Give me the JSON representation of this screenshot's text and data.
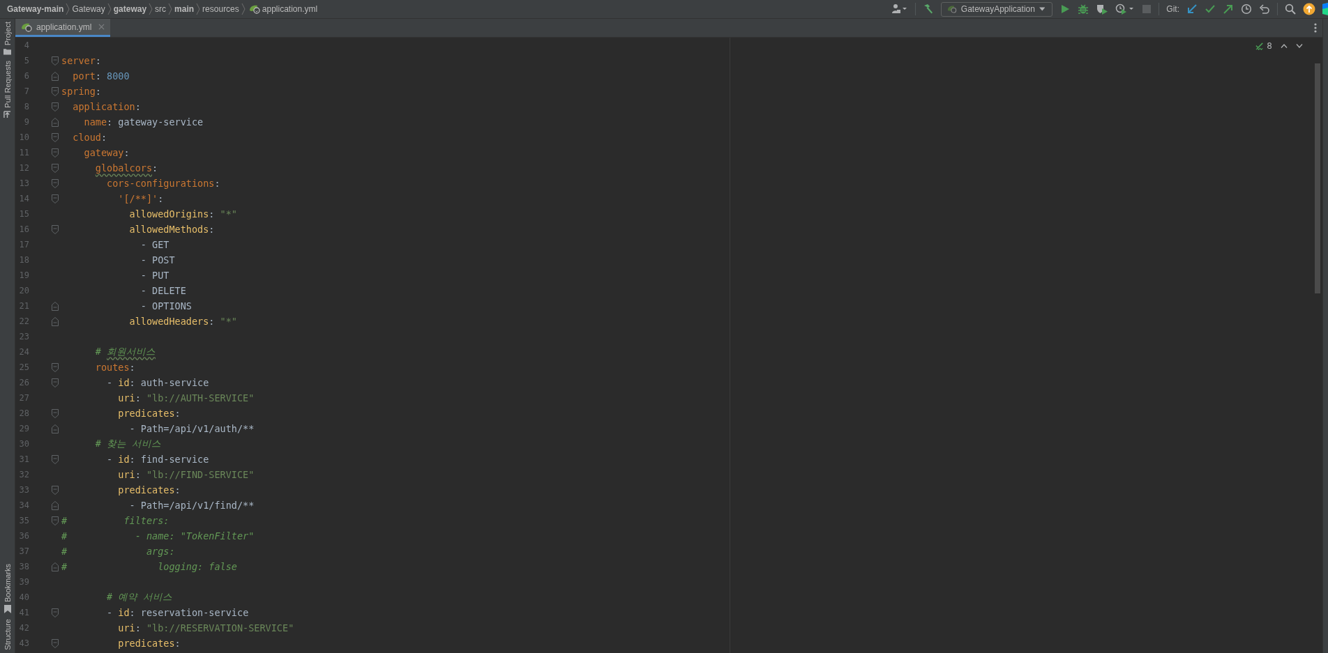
{
  "breadcrumbs": [
    {
      "label": "Gateway-main",
      "bold": true
    },
    {
      "label": "Gateway",
      "bold": false
    },
    {
      "label": "gateway",
      "bold": true
    },
    {
      "label": "src",
      "bold": false
    },
    {
      "label": "main",
      "bold": true
    },
    {
      "label": "resources",
      "bold": false
    },
    {
      "label": "application.yml",
      "bold": false
    }
  ],
  "toolbar": {
    "run_config": "GatewayApplication",
    "git_label": "Git:",
    "stop_disabled": true
  },
  "left_tools": [
    {
      "label": "Project"
    },
    {
      "label": "Pull Requests"
    },
    {
      "label": "Bookmarks"
    },
    {
      "label": "Structure"
    }
  ],
  "tabs": [
    {
      "label": "application.yml",
      "selected": true
    }
  ],
  "inspections": {
    "count": "8"
  },
  "lines": [
    {
      "n": "4",
      "kind": "plain"
    },
    {
      "n": "5",
      "kind": "open",
      "tokens": [
        {
          "kind": "key",
          "text": "server",
          "typo": false
        },
        {
          "kind": "punct",
          "text": ":",
          "typo": false
        }
      ]
    },
    {
      "n": "6",
      "kind": "close",
      "tokens": [
        {
          "kind": "key",
          "text": "  port",
          "typo": false
        },
        {
          "kind": "punct",
          "text": ": ",
          "typo": false
        },
        {
          "kind": "num",
          "text": "8000",
          "typo": false
        }
      ]
    },
    {
      "n": "7",
      "kind": "open",
      "tokens": [
        {
          "kind": "key",
          "text": "spring",
          "typo": false
        },
        {
          "kind": "punct",
          "text": ":",
          "typo": false
        }
      ]
    },
    {
      "n": "8",
      "kind": "open",
      "tokens": [
        {
          "kind": "key",
          "text": "  application",
          "typo": false
        },
        {
          "kind": "punct",
          "text": ":",
          "typo": false
        }
      ]
    },
    {
      "n": "9",
      "kind": "close",
      "tokens": [
        {
          "kind": "key",
          "text": "    name",
          "typo": false
        },
        {
          "kind": "punct",
          "text": ": ",
          "typo": false
        },
        {
          "kind": "val",
          "text": "gateway-service",
          "typo": false
        }
      ]
    },
    {
      "n": "10",
      "kind": "open",
      "tokens": [
        {
          "kind": "key",
          "text": "  cloud",
          "typo": false
        },
        {
          "kind": "punct",
          "text": ":",
          "typo": false
        }
      ]
    },
    {
      "n": "11",
      "kind": "open",
      "tokens": [
        {
          "kind": "key",
          "text": "    gateway",
          "typo": false
        },
        {
          "kind": "punct",
          "text": ":",
          "typo": false
        }
      ]
    },
    {
      "n": "12",
      "kind": "open",
      "tokens": [
        {
          "kind": "key",
          "text": "      globalcors",
          "typo": true
        },
        {
          "kind": "punct",
          "text": ":",
          "typo": false
        }
      ]
    },
    {
      "n": "13",
      "kind": "open",
      "tokens": [
        {
          "kind": "key",
          "text": "        cors-configurations",
          "typo": false
        },
        {
          "kind": "punct",
          "text": ":",
          "typo": false
        }
      ]
    },
    {
      "n": "14",
      "kind": "open",
      "tokens": [
        {
          "kind": "key",
          "text": "          '[/**]'",
          "typo": false
        },
        {
          "kind": "punct",
          "text": ":",
          "typo": false
        }
      ]
    },
    {
      "n": "15",
      "kind": "plain",
      "tokens": [
        {
          "kind": "key2",
          "text": "            allowedOrigins",
          "typo": false
        },
        {
          "kind": "punct",
          "text": ": ",
          "typo": false
        },
        {
          "kind": "str",
          "text": "\"*\"",
          "typo": false
        }
      ]
    },
    {
      "n": "16",
      "kind": "open",
      "tokens": [
        {
          "kind": "key2",
          "text": "            allowedMethods",
          "typo": false
        },
        {
          "kind": "punct",
          "text": ":",
          "typo": false
        }
      ]
    },
    {
      "n": "17",
      "kind": "plain",
      "tokens": [
        {
          "kind": "val",
          "text": "              - GET",
          "typo": false
        }
      ]
    },
    {
      "n": "18",
      "kind": "plain",
      "tokens": [
        {
          "kind": "val",
          "text": "              - POST",
          "typo": false
        }
      ]
    },
    {
      "n": "19",
      "kind": "plain",
      "tokens": [
        {
          "kind": "val",
          "text": "              - PUT",
          "typo": false
        }
      ]
    },
    {
      "n": "20",
      "kind": "plain",
      "tokens": [
        {
          "kind": "val",
          "text": "              - DELETE",
          "typo": false
        }
      ]
    },
    {
      "n": "21",
      "kind": "close",
      "tokens": [
        {
          "kind": "val",
          "text": "              - OPTIONS",
          "typo": false
        }
      ]
    },
    {
      "n": "22",
      "kind": "close",
      "tokens": [
        {
          "kind": "key2",
          "text": "            allowedHeaders",
          "typo": false
        },
        {
          "kind": "punct",
          "text": ": ",
          "typo": false
        },
        {
          "kind": "str",
          "text": "\"*\"",
          "typo": false
        }
      ]
    },
    {
      "n": "23",
      "kind": "plain"
    },
    {
      "n": "24",
      "kind": "plain",
      "tokens": [
        {
          "kind": "cmt",
          "text": "      # ",
          "typo": false
        },
        {
          "kind": "cmt",
          "text": "회원서비스",
          "typo": true
        }
      ]
    },
    {
      "n": "25",
      "kind": "open",
      "tokens": [
        {
          "kind": "key",
          "text": "      routes",
          "typo": false
        },
        {
          "kind": "punct",
          "text": ":",
          "typo": false
        }
      ]
    },
    {
      "n": "26",
      "kind": "open",
      "tokens": [
        {
          "kind": "val",
          "text": "        - ",
          "typo": false
        },
        {
          "kind": "key2",
          "text": "id",
          "typo": false
        },
        {
          "kind": "punct",
          "text": ": ",
          "typo": false
        },
        {
          "kind": "val",
          "text": "auth-service",
          "typo": false
        }
      ]
    },
    {
      "n": "27",
      "kind": "plain",
      "tokens": [
        {
          "kind": "key2",
          "text": "          uri",
          "typo": false
        },
        {
          "kind": "punct",
          "text": ": ",
          "typo": false
        },
        {
          "kind": "str",
          "text": "\"lb://AUTH-SERVICE\"",
          "typo": false
        }
      ]
    },
    {
      "n": "28",
      "kind": "open",
      "tokens": [
        {
          "kind": "key2",
          "text": "          predicates",
          "typo": false
        },
        {
          "kind": "punct",
          "text": ":",
          "typo": false
        }
      ]
    },
    {
      "n": "29",
      "kind": "close",
      "tokens": [
        {
          "kind": "val",
          "text": "            - Path=/api/v1/auth/**",
          "typo": false
        }
      ]
    },
    {
      "n": "30",
      "kind": "plain",
      "tokens": [
        {
          "kind": "cmt",
          "text": "      # 찾는 서비스",
          "typo": false
        }
      ]
    },
    {
      "n": "31",
      "kind": "open",
      "tokens": [
        {
          "kind": "val",
          "text": "        - ",
          "typo": false
        },
        {
          "kind": "key2",
          "text": "id",
          "typo": false
        },
        {
          "kind": "punct",
          "text": ": ",
          "typo": false
        },
        {
          "kind": "val",
          "text": "find-service",
          "typo": false
        }
      ]
    },
    {
      "n": "32",
      "kind": "plain",
      "tokens": [
        {
          "kind": "key2",
          "text": "          uri",
          "typo": false
        },
        {
          "kind": "punct",
          "text": ": ",
          "typo": false
        },
        {
          "kind": "str",
          "text": "\"lb://FIND-SERVICE\"",
          "typo": false
        }
      ]
    },
    {
      "n": "33",
      "kind": "open",
      "tokens": [
        {
          "kind": "key2",
          "text": "          predicates",
          "typo": false
        },
        {
          "kind": "punct",
          "text": ":",
          "typo": false
        }
      ]
    },
    {
      "n": "34",
      "kind": "close",
      "tokens": [
        {
          "kind": "val",
          "text": "            - Path=/api/v1/find/**",
          "typo": false
        }
      ]
    },
    {
      "n": "35",
      "kind": "open",
      "tokens": [
        {
          "kind": "cmt",
          "text": "#          filters:",
          "typo": false
        }
      ]
    },
    {
      "n": "36",
      "kind": "plain",
      "tokens": [
        {
          "kind": "cmt",
          "text": "#            - name: \"TokenFilter\"",
          "typo": false
        }
      ]
    },
    {
      "n": "37",
      "kind": "plain",
      "tokens": [
        {
          "kind": "cmt",
          "text": "#              args:",
          "typo": false
        }
      ]
    },
    {
      "n": "38",
      "kind": "close",
      "tokens": [
        {
          "kind": "cmt",
          "text": "#                logging: false",
          "typo": false
        }
      ]
    },
    {
      "n": "39",
      "kind": "plain"
    },
    {
      "n": "40",
      "kind": "plain",
      "tokens": [
        {
          "kind": "cmt",
          "text": "        # 예약 서비스",
          "typo": false
        }
      ]
    },
    {
      "n": "41",
      "kind": "open",
      "tokens": [
        {
          "kind": "val",
          "text": "        - ",
          "typo": false
        },
        {
          "kind": "key2",
          "text": "id",
          "typo": false
        },
        {
          "kind": "punct",
          "text": ": ",
          "typo": false
        },
        {
          "kind": "val",
          "text": "reservation-service",
          "typo": false
        }
      ]
    },
    {
      "n": "42",
      "kind": "plain",
      "tokens": [
        {
          "kind": "key2",
          "text": "          uri",
          "typo": false
        },
        {
          "kind": "punct",
          "text": ": ",
          "typo": false
        },
        {
          "kind": "str",
          "text": "\"lb://RESERVATION-SERVICE\"",
          "typo": false
        }
      ]
    },
    {
      "n": "43",
      "kind": "open",
      "tokens": [
        {
          "kind": "key2",
          "text": "          predicates",
          "typo": false
        },
        {
          "kind": "punct",
          "text": ":",
          "typo": false
        }
      ]
    }
  ]
}
